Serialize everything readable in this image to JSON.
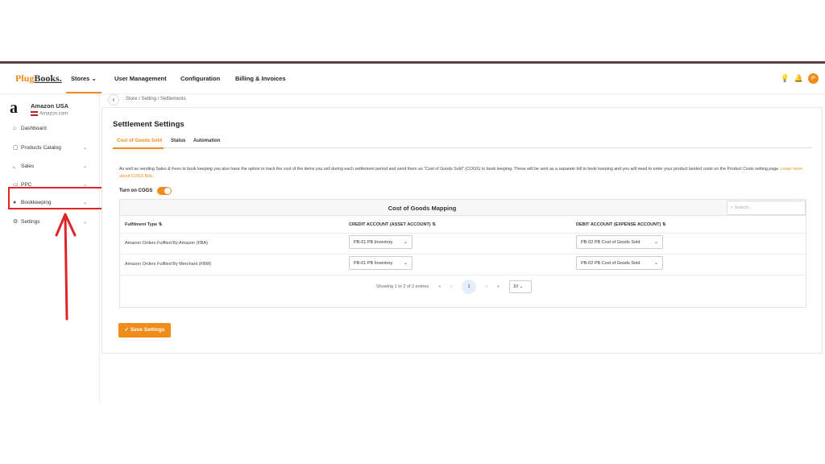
{
  "logo": {
    "plug": "Plug",
    "books": "Books."
  },
  "nav": {
    "items": [
      {
        "label": "Stores"
      },
      {
        "label": "User Management"
      },
      {
        "label": "Configuration"
      },
      {
        "label": "Billing & Invoices"
      }
    ],
    "avatar_initial": "P"
  },
  "store": {
    "name": "Amazon USA",
    "domain": "Amazon.com",
    "logo_glyph": "a"
  },
  "sidebar": {
    "items": [
      {
        "label": "Dashboard",
        "icon": "home-icon"
      },
      {
        "label": "Products Catalog",
        "icon": "box-icon"
      },
      {
        "label": "Sales",
        "icon": "chart-icon"
      },
      {
        "label": "PPC",
        "icon": "ppc-icon"
      },
      {
        "label": "Bookkeeping",
        "icon": "book-icon"
      },
      {
        "label": "Settings",
        "icon": "gear-icon"
      }
    ]
  },
  "breadcrumb": "Store  /  Setting  /  Settlements",
  "page": {
    "title": "Settlement Settings",
    "tabs": [
      {
        "label": "Cost of Goods Sold"
      },
      {
        "label": "Status"
      },
      {
        "label": "Automation"
      }
    ],
    "description": "As well as sending Sales & Fees to book keeping you also have the option to track the cost of the items you sell during each settlement period and send them as \"Cost of Goods Sold\" (COGS) to book keeping. These will be sent as a separate bill to book keeping and you will need to enter your product landed costs on the Product Costs setting page.",
    "description_link": "Learn more about COGS Bills.",
    "toggle_label": "Turn on COGS",
    "toggle_on": true,
    "save_label": "Save Settings"
  },
  "table": {
    "title": "Cost of Goods Mapping",
    "search_placeholder": "Search...",
    "columns": [
      "Fulfilment Type",
      "CREDIT ACCOUNT (ASSET ACCOUNT)",
      "DEBIT ACCOUNT (EXPENSE ACCOUNT)"
    ],
    "rows": [
      {
        "type": "Amazon Orders Fulfiled By Amazon (FBA)",
        "credit": "PB-01 PB Inventory",
        "debit": "PB-02 PB Cost of Goods Sold"
      },
      {
        "type": "Amazon Orders Fulfiled By Merchant (FBM)",
        "credit": "PB-01 PB Inventory",
        "debit": "PB-02 PB Cost of Goods Sold"
      }
    ],
    "pagination": {
      "summary": "Showing 1 to 2 of 2 entries",
      "page": "1",
      "per_page": "10"
    }
  },
  "colors": {
    "accent": "#f08c1a",
    "highlight": "#e0252a"
  }
}
